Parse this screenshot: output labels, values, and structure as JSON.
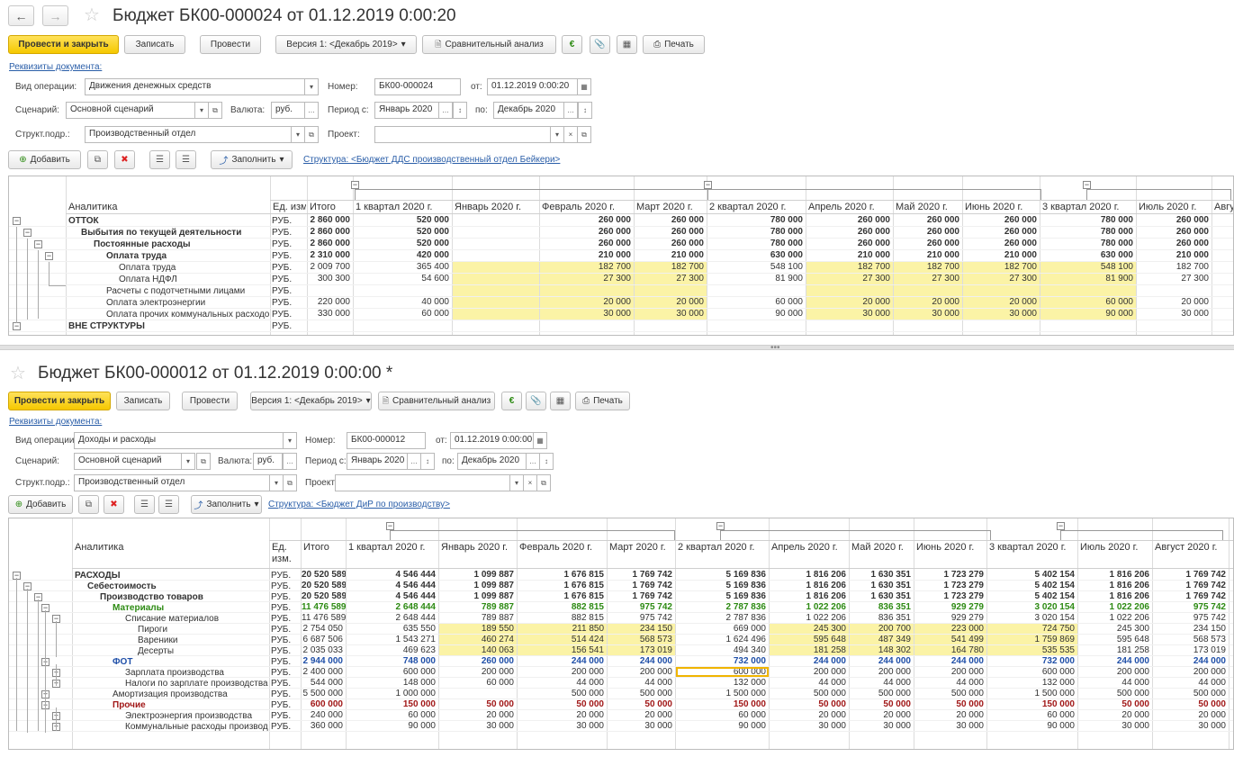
{
  "top": {
    "title": "Бюджет БК00-000024 от 01.12.2019 0:00:20",
    "buttons": {
      "post_close": "Провести и закрыть",
      "save": "Записать",
      "post": "Провести",
      "version": "Версия 1: <Декабрь 2019>",
      "compare": "Сравнительный анализ",
      "print": "Печать"
    },
    "details_link": "Реквизиты документа:",
    "fields": {
      "op_label": "Вид операции:",
      "op_value": "Движения денежных средств",
      "num_label": "Номер:",
      "num_value": "БК00-000024",
      "from_label": "от:",
      "from_value": "01.12.2019  0:00:20",
      "scen_label": "Сценарий:",
      "scen_value": "Основной сценарий",
      "cur_label": "Валюта:",
      "cur_value": "руб.",
      "per_label": "Период с:",
      "per_value": "Январь 2020",
      "to_label": "по:",
      "to_value": "Декабрь 2020",
      "dept_label": "Структ.подр.:",
      "dept_value": "Производственный отдел",
      "proj_label": "Проект:",
      "proj_value": ""
    },
    "toolbar": {
      "add": "Добавить",
      "fill": "Заполнить",
      "structure_link": "Структура: <Бюджет ДДС производственный отдел Бейкери>"
    },
    "table": {
      "headers": [
        "Аналитика",
        "Ед. изм.",
        "Итого",
        "1 квартал 2020 г.",
        "Январь 2020 г.",
        "Февраль 2020 г.",
        "Март 2020 г.",
        "2 квартал 2020 г.",
        "Апрель 2020 г.",
        "Май 2020 г.",
        "Июнь 2020 г.",
        "3 квартал 2020 г.",
        "Июль 2020 г.",
        "Авгу"
      ],
      "rows": [
        {
          "name": "ОТТОК",
          "unit": "РУБ.",
          "vals": [
            "2 860 000",
            "520 000",
            "",
            "260 000",
            "260 000",
            "780 000",
            "260 000",
            "260 000",
            "260 000",
            "780 000",
            "260 000"
          ]
        },
        {
          "name": "Выбытия по текущей деятельности",
          "unit": "РУБ.",
          "vals": [
            "2 860 000",
            "520 000",
            "",
            "260 000",
            "260 000",
            "780 000",
            "260 000",
            "260 000",
            "260 000",
            "780 000",
            "260 000"
          ]
        },
        {
          "name": "Постоянные расходы",
          "unit": "РУБ.",
          "vals": [
            "2 860 000",
            "520 000",
            "",
            "260 000",
            "260 000",
            "780 000",
            "260 000",
            "260 000",
            "260 000",
            "780 000",
            "260 000"
          ]
        },
        {
          "name": "Оплата труда",
          "unit": "РУБ.",
          "vals": [
            "2 310 000",
            "420 000",
            "",
            "210 000",
            "210 000",
            "630 000",
            "210 000",
            "210 000",
            "210 000",
            "630 000",
            "210 000"
          ]
        },
        {
          "name": "Оплата труда",
          "unit": "РУБ.",
          "vals": [
            "2 009 700",
            "365 400",
            "",
            "182 700",
            "182 700",
            "548 100",
            "182 700",
            "182 700",
            "182 700",
            "548 100",
            "182 700"
          ]
        },
        {
          "name": "Оплата НДФЛ",
          "unit": "РУБ.",
          "vals": [
            "300 300",
            "54 600",
            "",
            "27 300",
            "27 300",
            "81 900",
            "27 300",
            "27 300",
            "27 300",
            "81 900",
            "27 300"
          ]
        },
        {
          "name": "Расчеты с подотчетными лицами",
          "unit": "РУБ.",
          "vals": [
            "",
            "",
            "",
            "",
            "",
            "",
            "",
            "",
            "",
            "",
            ""
          ]
        },
        {
          "name": "Оплата электроэнергии",
          "unit": "РУБ.",
          "vals": [
            "220 000",
            "40 000",
            "",
            "20 000",
            "20 000",
            "60 000",
            "20 000",
            "20 000",
            "20 000",
            "60 000",
            "20 000"
          ]
        },
        {
          "name": "Оплата прочих коммунальных расходов",
          "unit": "РУБ.",
          "vals": [
            "330 000",
            "60 000",
            "",
            "30 000",
            "30 000",
            "90 000",
            "30 000",
            "30 000",
            "30 000",
            "90 000",
            "30 000"
          ]
        },
        {
          "name": "ВНЕ СТРУКТУРЫ",
          "unit": "РУБ.",
          "vals": [
            "",
            "",
            "",
            "",
            "",
            "",
            "",
            "",
            "",
            "",
            ""
          ]
        }
      ]
    }
  },
  "bottom": {
    "title": "Бюджет БК00-000012 от 01.12.2019 0:00:00 *",
    "buttons": {
      "post_close": "Провести и закрыть",
      "save": "Записать",
      "post": "Провести",
      "version": "Версия 1: <Декабрь 2019>",
      "compare": "Сравнительный анализ",
      "print": "Печать"
    },
    "details_link": "Реквизиты документа:",
    "fields": {
      "op_label": "Вид операции:",
      "op_value": "Доходы и расходы",
      "num_label": "Номер:",
      "num_value": "БК00-000012",
      "from_label": "от:",
      "from_value": "01.12.2019  0:00:00",
      "scen_label": "Сценарий:",
      "scen_value": "Основной сценарий",
      "cur_label": "Валюта:",
      "cur_value": "руб.",
      "per_label": "Период с:",
      "per_value": "Январь 2020",
      "to_label": "по:",
      "to_value": "Декабрь 2020",
      "dept_label": "Структ.подр.:",
      "dept_value": "Производственный отдел",
      "proj_label": "Проект:",
      "proj_value": ""
    },
    "toolbar": {
      "add": "Добавить",
      "fill": "Заполнить",
      "structure_link": "Структура: <Бюджет ДиР по производству>"
    },
    "table": {
      "headers": [
        "Аналитика",
        "Ед. изм.",
        "Итого",
        "1 квартал 2020 г.",
        "Январь 2020 г.",
        "Февраль 2020 г.",
        "Март 2020 г.",
        "2 квартал 2020 г.",
        "Апрель 2020 г.",
        "Май 2020 г.",
        "Июнь 2020 г.",
        "3 квартал 2020 г.",
        "Июль 2020 г.",
        "Август 2020 г."
      ],
      "rows": [
        {
          "name": "РАСХОДЫ",
          "unit": "РУБ.",
          "vals": [
            "20 520 589",
            "4 546 444",
            "1 099 887",
            "1 676 815",
            "1 769 742",
            "5 169 836",
            "1 816 206",
            "1 630 351",
            "1 723 279",
            "5 402 154",
            "1 816 206",
            "1 769 742"
          ]
        },
        {
          "name": "Себестоимость",
          "unit": "РУБ.",
          "vals": [
            "20 520 589",
            "4 546 444",
            "1 099 887",
            "1 676 815",
            "1 769 742",
            "5 169 836",
            "1 816 206",
            "1 630 351",
            "1 723 279",
            "5 402 154",
            "1 816 206",
            "1 769 742"
          ]
        },
        {
          "name": "Производство товаров",
          "unit": "РУБ.",
          "vals": [
            "20 520 589",
            "4 546 444",
            "1 099 887",
            "1 676 815",
            "1 769 742",
            "5 169 836",
            "1 816 206",
            "1 630 351",
            "1 723 279",
            "5 402 154",
            "1 816 206",
            "1 769 742"
          ]
        },
        {
          "name": "Материалы",
          "unit": "РУБ.",
          "vals": [
            "11 476 589",
            "2 648 444",
            "789 887",
            "882 815",
            "975 742",
            "2 787 836",
            "1 022 206",
            "836 351",
            "929 279",
            "3 020 154",
            "1 022 206",
            "975 742"
          ]
        },
        {
          "name": "Списание материалов",
          "unit": "РУБ.",
          "vals": [
            "11 476 589",
            "2 648 444",
            "789 887",
            "882 815",
            "975 742",
            "2 787 836",
            "1 022 206",
            "836 351",
            "929 279",
            "3 020 154",
            "1 022 206",
            "975 742"
          ]
        },
        {
          "name": "Пироги",
          "unit": "РУБ.",
          "vals": [
            "2 754 050",
            "635 550",
            "189 550",
            "211 850",
            "234 150",
            "669 000",
            "245 300",
            "200 700",
            "223 000",
            "724 750",
            "245 300",
            "234 150"
          ]
        },
        {
          "name": "Вареники",
          "unit": "РУБ.",
          "vals": [
            "6 687 506",
            "1 543 271",
            "460 274",
            "514 424",
            "568 573",
            "1 624 496",
            "595 648",
            "487 349",
            "541 499",
            "1 759 869",
            "595 648",
            "568 573"
          ]
        },
        {
          "name": "Десерты",
          "unit": "РУБ.",
          "vals": [
            "2 035 033",
            "469 623",
            "140 063",
            "156 541",
            "173 019",
            "494 340",
            "181 258",
            "148 302",
            "164 780",
            "535 535",
            "181 258",
            "173 019"
          ]
        },
        {
          "name": "ФОТ",
          "unit": "РУБ.",
          "vals": [
            "2 944 000",
            "748 000",
            "260 000",
            "244 000",
            "244 000",
            "732 000",
            "244 000",
            "244 000",
            "244 000",
            "732 000",
            "244 000",
            "244 000"
          ]
        },
        {
          "name": "Зарплата производства",
          "unit": "РУБ.",
          "vals": [
            "2 400 000",
            "600 000",
            "200 000",
            "200 000",
            "200 000",
            "600 000",
            "200 000",
            "200 000",
            "200 000",
            "600 000",
            "200 000",
            "200 000"
          ]
        },
        {
          "name": "Налоги по зарплате производства",
          "unit": "РУБ.",
          "vals": [
            "544 000",
            "148 000",
            "60 000",
            "44 000",
            "44 000",
            "132 000",
            "44 000",
            "44 000",
            "44 000",
            "132 000",
            "44 000",
            "44 000"
          ]
        },
        {
          "name": "Амортизация производства",
          "unit": "РУБ.",
          "vals": [
            "5 500 000",
            "1 000 000",
            "",
            "500 000",
            "500 000",
            "1 500 000",
            "500 000",
            "500 000",
            "500 000",
            "1 500 000",
            "500 000",
            "500 000"
          ]
        },
        {
          "name": "Прочие",
          "unit": "РУБ.",
          "vals": [
            "600 000",
            "150 000",
            "50 000",
            "50 000",
            "50 000",
            "150 000",
            "50 000",
            "50 000",
            "50 000",
            "150 000",
            "50 000",
            "50 000"
          ]
        },
        {
          "name": "Электроэнергия производства",
          "unit": "РУБ.",
          "vals": [
            "240 000",
            "60 000",
            "20 000",
            "20 000",
            "20 000",
            "60 000",
            "20 000",
            "20 000",
            "20 000",
            "60 000",
            "20 000",
            "20 000"
          ]
        },
        {
          "name": "Коммунальные расходы производства",
          "unit": "РУБ.",
          "vals": [
            "360 000",
            "90 000",
            "30 000",
            "30 000",
            "30 000",
            "90 000",
            "30 000",
            "30 000",
            "30 000",
            "90 000",
            "30 000",
            "30 000"
          ]
        }
      ]
    }
  }
}
